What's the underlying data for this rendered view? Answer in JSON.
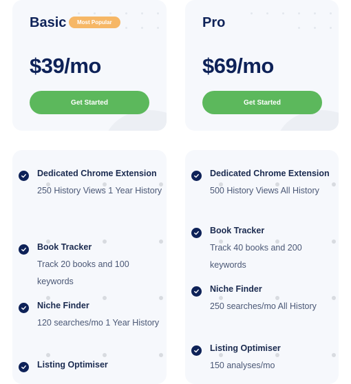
{
  "plans": [
    {
      "name": "Basic",
      "badge": "Most Popular",
      "price": "$39/mo",
      "cta": "Get Started",
      "features": [
        {
          "title": "Dedicated Chrome Extension",
          "desc": "250 History Views 1 Year History"
        },
        {
          "title": "Book Tracker",
          "desc": "Track 20 books and 100 keywords"
        },
        {
          "title": "Niche Finder",
          "desc": "120 searches/mo 1 Year History"
        },
        {
          "title": "Listing Optimiser",
          "desc": ""
        }
      ]
    },
    {
      "name": "Pro",
      "badge": "",
      "price": "$69/mo",
      "cta": "Get Started",
      "features": [
        {
          "title": "Dedicated Chrome Extension",
          "desc": "500 History Views All History"
        },
        {
          "title": "Book Tracker",
          "desc": "Track 40 books and 200 keywords"
        },
        {
          "title": "Niche Finder",
          "desc": "250 searches/mo All History"
        },
        {
          "title": "Listing Optimiser",
          "desc": "150 analyses/mo"
        }
      ]
    }
  ],
  "colors": {
    "navy": "#0e2258",
    "cta_green": "#5cb85c",
    "badge_orange": "#f6b766"
  },
  "icons": {
    "feature_check": "check-circle-icon"
  }
}
